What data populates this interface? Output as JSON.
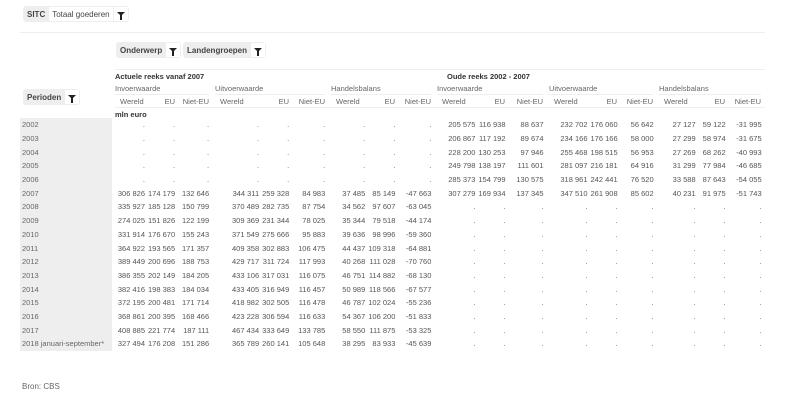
{
  "filters": {
    "sitc_label": "SITC",
    "sitc_value": "Totaal goederen",
    "onderwerp": "Onderwerp",
    "landengroepen": "Landengroepen",
    "perioden": "Perioden"
  },
  "headers": {
    "new_series": "Actuele reeks vanaf 2007",
    "old_series": "Oude reeks 2002 - 2007",
    "groups": [
      "Invoerwaarde",
      "Uitvoerwaarde",
      "Handelsbalans"
    ],
    "cols": [
      "Wereld",
      "EU",
      "Niet-EU"
    ],
    "unit": "mln euro"
  },
  "rows": [
    [
      "2002",
      ".",
      ".",
      ".",
      ".",
      ".",
      ".",
      ".",
      ".",
      ".",
      "205 575",
      "116 938",
      "88 637",
      "232 702",
      "176 060",
      "56 642",
      "27 127",
      "59 122",
      "-31 995"
    ],
    [
      "2003",
      ".",
      ".",
      ".",
      ".",
      ".",
      ".",
      ".",
      ".",
      ".",
      "206 867",
      "117 192",
      "89 674",
      "234 166",
      "176 166",
      "58 000",
      "27 299",
      "58 974",
      "-31 675"
    ],
    [
      "2004",
      ".",
      ".",
      ".",
      ".",
      ".",
      ".",
      ".",
      ".",
      ".",
      "228 200",
      "130 253",
      "97 946",
      "255 468",
      "198 515",
      "56 953",
      "27 269",
      "68 262",
      "-40 993"
    ],
    [
      "2005",
      ".",
      ".",
      ".",
      ".",
      ".",
      ".",
      ".",
      ".",
      ".",
      "249 798",
      "138 197",
      "111 601",
      "281 097",
      "216 181",
      "64 916",
      "31 299",
      "77 984",
      "-46 685"
    ],
    [
      "2006",
      ".",
      ".",
      ".",
      ".",
      ".",
      ".",
      ".",
      ".",
      ".",
      "285 373",
      "154 799",
      "130 575",
      "318 961",
      "242 441",
      "76 520",
      "33 588",
      "87 643",
      "-54 055"
    ],
    [
      "2007",
      "306 826",
      "174 179",
      "132 646",
      "344 311",
      "259 328",
      "84 983",
      "37 485",
      "85 149",
      "-47 663",
      "307 279",
      "169 934",
      "137 345",
      "347 510",
      "261 908",
      "85 602",
      "40 231",
      "91 975",
      "-51 743"
    ],
    [
      "2008",
      "335 927",
      "185 128",
      "150 799",
      "370 489",
      "282 735",
      "87 754",
      "34 562",
      "97 607",
      "-63 045",
      ".",
      ".",
      ".",
      ".",
      ".",
      ".",
      ".",
      ".",
      "."
    ],
    [
      "2009",
      "274 025",
      "151 826",
      "122 199",
      "309 369",
      "231 344",
      "78 025",
      "35 344",
      "79 518",
      "-44 174",
      ".",
      ".",
      ".",
      ".",
      ".",
      ".",
      ".",
      ".",
      "."
    ],
    [
      "2010",
      "331 914",
      "176 670",
      "155 243",
      "371 549",
      "275 666",
      "95 883",
      "39 636",
      "98 996",
      "-59 360",
      ".",
      ".",
      ".",
      ".",
      ".",
      ".",
      ".",
      ".",
      "."
    ],
    [
      "2011",
      "364 922",
      "193 565",
      "171 357",
      "409 358",
      "302 883",
      "106 475",
      "44 437",
      "109 318",
      "-64 881",
      ".",
      ".",
      ".",
      ".",
      ".",
      ".",
      ".",
      ".",
      "."
    ],
    [
      "2012",
      "389 449",
      "200 696",
      "188 753",
      "429 717",
      "311 724",
      "117 993",
      "40 268",
      "111 028",
      "-70 760",
      ".",
      ".",
      ".",
      ".",
      ".",
      ".",
      ".",
      ".",
      "."
    ],
    [
      "2013",
      "386 355",
      "202 149",
      "184 205",
      "433 106",
      "317 031",
      "116 075",
      "46 751",
      "114 882",
      "-68 130",
      ".",
      ".",
      ".",
      ".",
      ".",
      ".",
      ".",
      ".",
      "."
    ],
    [
      "2014",
      "382 416",
      "198 383",
      "184 034",
      "433 405",
      "316 949",
      "116 457",
      "50 989",
      "118 566",
      "-67 577",
      ".",
      ".",
      ".",
      ".",
      ".",
      ".",
      ".",
      ".",
      "."
    ],
    [
      "2015",
      "372 195",
      "200 481",
      "171 714",
      "418 982",
      "302 505",
      "116 478",
      "46 787",
      "102 024",
      "-55 236",
      ".",
      ".",
      ".",
      ".",
      ".",
      ".",
      ".",
      ".",
      "."
    ],
    [
      "2016",
      "368 861",
      "200 395",
      "168 466",
      "423 228",
      "306 594",
      "116 633",
      "54 367",
      "106 200",
      "-51 833",
      ".",
      ".",
      ".",
      ".",
      ".",
      ".",
      ".",
      ".",
      "."
    ],
    [
      "2017",
      "408 885",
      "221 774",
      "187 111",
      "467 434",
      "333 649",
      "133 785",
      "58 550",
      "111 875",
      "-53 325",
      ".",
      ".",
      ".",
      ".",
      ".",
      ".",
      ".",
      ".",
      "."
    ],
    [
      "2018 januari-september*",
      "327 494",
      "176 208",
      "151 286",
      "365 789",
      "260 141",
      "105 648",
      "38 295",
      "83 933",
      "-45 639",
      ".",
      ".",
      ".",
      ".",
      ".",
      ".",
      ".",
      ".",
      "."
    ]
  ],
  "source": "Bron: CBS"
}
